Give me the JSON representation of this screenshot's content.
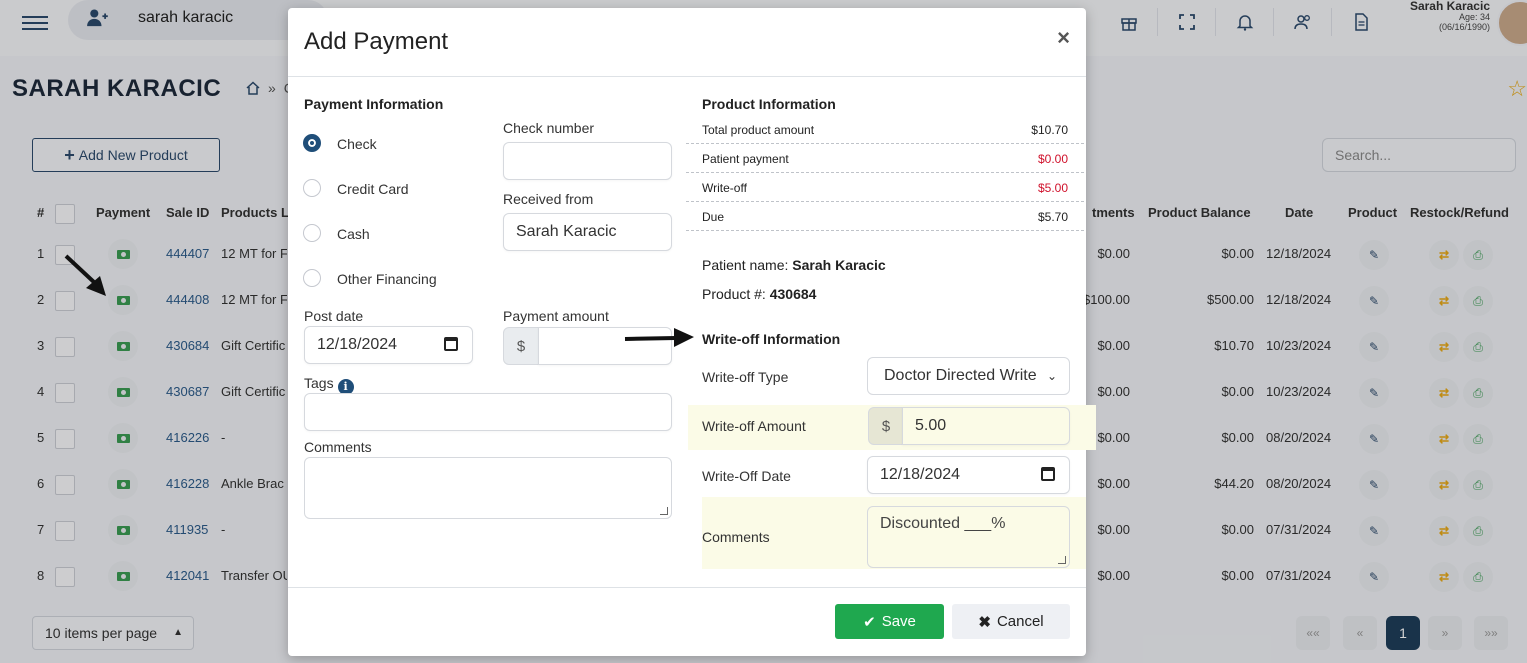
{
  "topbar": {
    "user_search_value": "sarah karacic",
    "icons": [
      "gift-icon",
      "fullscreen-icon",
      "bell-icon",
      "users-icon",
      "document-icon"
    ],
    "user": {
      "name": "Sarah Karacic",
      "age": "Age: 34",
      "dob": "(06/16/1990)"
    }
  },
  "page": {
    "title": "SARAH KARACIC",
    "breadcrumb_sep": "»",
    "breadcrumb_next": "C"
  },
  "table": {
    "add_button": "Add New Product",
    "search_placeholder": "Search...",
    "headers": {
      "num": "#",
      "payment": "Payment",
      "sale_id": "Sale ID",
      "products": "Products L",
      "payments": "tments",
      "balance": "Product Balance",
      "date": "Date",
      "product": "Product",
      "restock": "Restock/Refund"
    },
    "rows": [
      {
        "num": "1",
        "sale_id": "444407",
        "product": "12 MT for F",
        "payments": "$0.00",
        "balance": "$0.00",
        "date": "12/18/2024"
      },
      {
        "num": "2",
        "sale_id": "444408",
        "product": "12 MT for F",
        "payments": "$100.00",
        "balance": "$500.00",
        "date": "12/18/2024"
      },
      {
        "num": "3",
        "sale_id": "430684",
        "product": "Gift Certific",
        "payments": "$0.00",
        "balance": "$10.70",
        "date": "10/23/2024"
      },
      {
        "num": "4",
        "sale_id": "430687",
        "product": "Gift Certific",
        "payments": "$0.00",
        "balance": "$0.00",
        "date": "10/23/2024"
      },
      {
        "num": "5",
        "sale_id": "416226",
        "product": "-",
        "payments": "$0.00",
        "balance": "$0.00",
        "date": "08/20/2024"
      },
      {
        "num": "6",
        "sale_id": "416228",
        "product": "Ankle Brac",
        "payments": "$0.00",
        "balance": "$44.20",
        "date": "08/20/2024"
      },
      {
        "num": "7",
        "sale_id": "411935",
        "product": "-",
        "payments": "$0.00",
        "balance": "$0.00",
        "date": "07/31/2024"
      },
      {
        "num": "8",
        "sale_id": "412041",
        "product": "Transfer OU",
        "payments": "$0.00",
        "balance": "$0.00",
        "date": "07/31/2024"
      }
    ],
    "per_page": "10 items per page",
    "pager": {
      "first": "««",
      "prev": "«",
      "current": "1",
      "next": "»",
      "last": "»»"
    }
  },
  "modal": {
    "title": "Add Payment",
    "close": "×",
    "payment_info": {
      "title": "Payment Information",
      "methods": [
        {
          "label": "Check",
          "selected": true
        },
        {
          "label": "Credit Card",
          "selected": false
        },
        {
          "label": "Cash",
          "selected": false
        },
        {
          "label": "Other Financing",
          "selected": false
        }
      ],
      "check_number_label": "Check number",
      "check_number_value": "",
      "received_from_label": "Received from",
      "received_from_value": "Sarah Karacic",
      "post_date_label": "Post date",
      "post_date_value": "12/18/2024",
      "payment_amount_label": "Payment amount",
      "currency": "$",
      "payment_amount_value": "",
      "tags_label": "Tags",
      "info_icon": "i",
      "comments_label": "Comments"
    },
    "product_info": {
      "title": "Product Information",
      "rows": [
        {
          "label": "Total product amount",
          "value": "$10.70",
          "color": "#222222"
        },
        {
          "label": "Patient payment",
          "value": "$0.00",
          "color": "#d0112b"
        },
        {
          "label": "Write-off",
          "value": "$5.00",
          "color": "#d0112b"
        },
        {
          "label": "Due",
          "value": "$5.70",
          "color": "#222222"
        }
      ],
      "patient_name_label": "Patient name:",
      "patient_name": "Sarah Karacic",
      "product_num_label": "Product #:",
      "product_num": "430684"
    },
    "writeoff": {
      "title": "Write-off Information",
      "type_label": "Write-off Type",
      "type_value": "Doctor Directed Write",
      "amount_label": "Write-off Amount",
      "currency": "$",
      "amount_value": "5.00",
      "date_label": "Write-Off Date",
      "date_value": "12/18/2024",
      "comments_label": "Comments",
      "comments_value": "Discounted ___%"
    },
    "save": "Save",
    "cancel": "Cancel"
  },
  "colors": {
    "primary": "#1f4e79",
    "save": "#1fa84f",
    "danger": "#d0112b",
    "highlight": "#fbfbe7"
  }
}
